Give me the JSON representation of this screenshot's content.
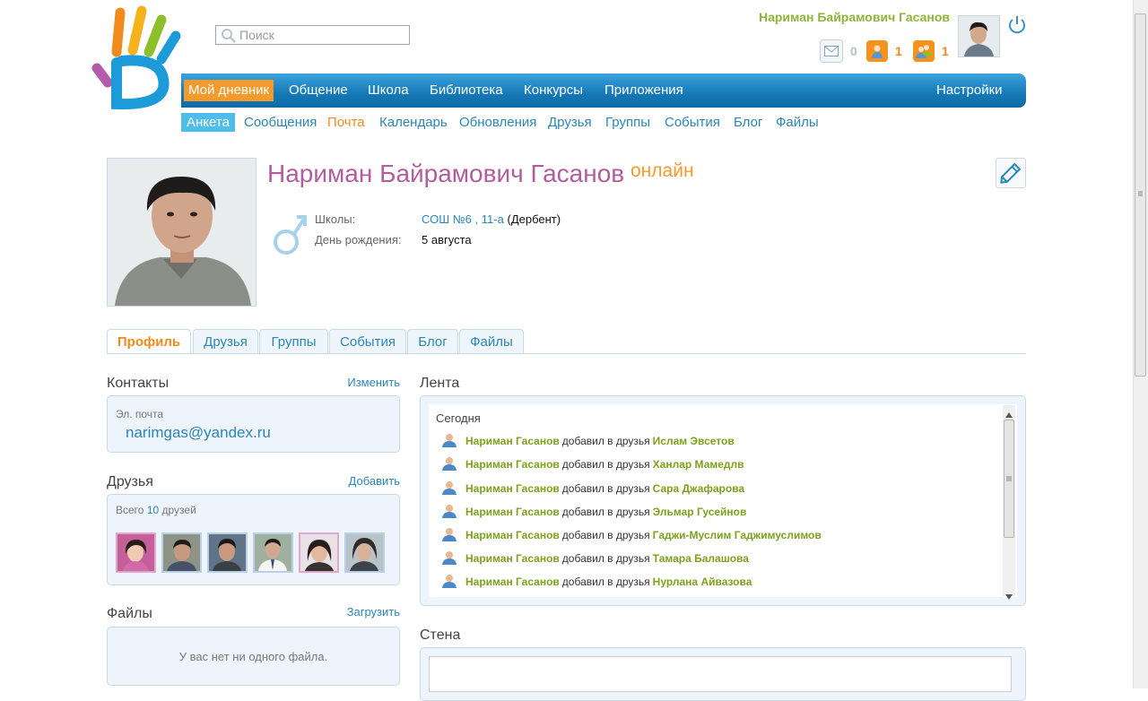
{
  "header": {
    "search_placeholder": "Поиск",
    "user_name": "Нариман Байрамович Гасанов",
    "counters": [
      {
        "icon": "mail-icon",
        "count": "0"
      },
      {
        "icon": "friend-request-icon",
        "count": "1"
      },
      {
        "icon": "group-invite-icon",
        "count": "1"
      }
    ]
  },
  "main_nav": [
    {
      "label": "Мой дневник",
      "active": true
    },
    {
      "label": "Общение"
    },
    {
      "label": "Школа"
    },
    {
      "label": "Библиотека"
    },
    {
      "label": "Конкурсы"
    },
    {
      "label": "Приложения"
    },
    {
      "label": "Настройки"
    }
  ],
  "sub_nav": [
    {
      "label": "Анкета",
      "active": true
    },
    {
      "label": "Сообщения"
    },
    {
      "label": "Почта"
    },
    {
      "label": "Календарь"
    },
    {
      "label": "Обновления"
    },
    {
      "label": "Друзья"
    },
    {
      "label": "Группы"
    },
    {
      "label": "События"
    },
    {
      "label": "Блог"
    },
    {
      "label": "Файлы"
    }
  ],
  "profile": {
    "full_name": "Нариман Байрамович Гасанов",
    "status": "онлайн",
    "schools_label": "Школы:",
    "school_name": "СОШ №6",
    "school_sep": ",",
    "school_class": "11-а",
    "school_city": "(Дербент)",
    "birthday_label": "День рождения:",
    "birthday": "5 августа"
  },
  "tabs": [
    "Профиль",
    "Друзья",
    "Группы",
    "События",
    "Блог",
    "Файлы"
  ],
  "contacts": {
    "title": "Контакты",
    "edit_link": "Изменить",
    "email_label": "Эл. почта",
    "email": "narimgas@yandex.ru"
  },
  "friends": {
    "title": "Друзья",
    "add_link": "Добавить",
    "total_prefix": "Всего",
    "total_count": "10",
    "total_suffix": "друзей"
  },
  "files": {
    "title": "Файлы",
    "upload_link": "Загрузить",
    "empty_text": "У вас нет ни одного файла."
  },
  "feed": {
    "title": "Лента",
    "day": "Сегодня",
    "items": [
      {
        "user": "Нариман Гасанов",
        "action": "добавил в друзья",
        "target": "Ислам Эвсетов"
      },
      {
        "user": "Нариман Гасанов",
        "action": "добавил в друзья",
        "target": "Ханлар Мамедлв"
      },
      {
        "user": "Нариман Гасанов",
        "action": "добавил в друзья",
        "target": "Сара Джафарова"
      },
      {
        "user": "Нариман Гасанов",
        "action": "добавил в друзья",
        "target": "Эльмар Гусейнов"
      },
      {
        "user": "Нариман Гасанов",
        "action": "добавил в друзья",
        "target": "Гаджи-Муслим Гаджимуслимов"
      },
      {
        "user": "Нариман Гасанов",
        "action": "добавил в друзья",
        "target": "Тамара Балашова"
      },
      {
        "user": "Нариман Гасанов",
        "action": "добавил в друзья",
        "target": "Нурлана Айвазова"
      }
    ]
  },
  "wall": {
    "title": "Стена"
  },
  "colors": {
    "accent_orange": "#f29b2c",
    "nav_blue": "#1678b6",
    "name_purple": "#b35d9c",
    "feed_green": "#7da11d"
  }
}
